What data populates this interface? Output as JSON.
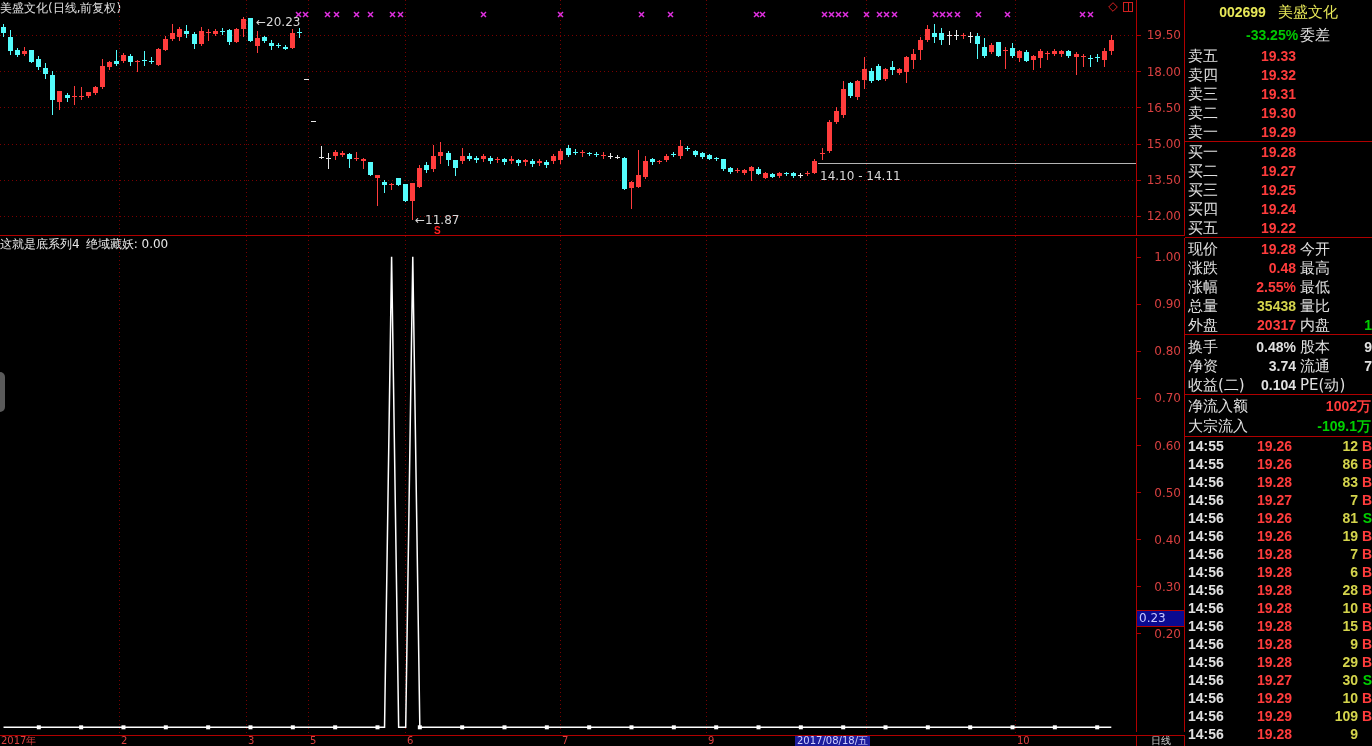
{
  "price_chart": {
    "title": "美盛文化(日线,前复权)",
    "high_label": "←20.23",
    "low_label": "←11.87",
    "signal_label": "S",
    "price_line_label": "14.10 - 14.11",
    "chart_data": {
      "type": "candlestick",
      "grid": true,
      "categories": [
        null,
        null,
        null,
        null,
        null,
        null,
        null,
        null,
        null,
        null,
        null,
        null,
        null,
        null,
        null,
        null,
        null,
        null,
        null,
        null,
        null,
        null,
        null,
        null,
        null,
        null,
        null,
        null,
        null,
        null,
        null,
        null,
        null,
        null,
        null,
        null,
        null,
        null,
        null,
        null,
        null,
        null,
        null,
        null,
        null,
        null,
        null,
        null,
        null,
        null,
        null,
        null,
        null,
        null,
        null,
        null,
        null,
        null,
        null,
        null,
        null,
        null,
        null,
        null,
        null,
        null,
        null,
        null,
        null,
        null,
        null,
        null,
        null,
        null,
        null,
        null,
        null,
        null,
        null,
        null,
        null,
        null,
        null,
        null,
        null,
        null,
        null,
        null,
        null,
        null,
        null,
        null,
        null,
        null,
        null,
        null,
        null,
        null,
        null,
        null,
        null,
        null,
        null,
        null,
        null,
        null,
        null,
        null,
        null,
        null,
        null,
        null,
        null,
        null,
        null,
        null,
        null,
        null,
        null,
        null,
        null,
        null,
        null,
        null,
        null,
        null,
        null,
        null,
        null,
        null,
        null,
        null,
        null,
        null,
        null,
        null,
        null,
        null,
        null,
        null,
        null,
        null,
        null,
        null,
        null,
        null,
        null,
        null,
        null,
        null,
        null,
        null,
        null,
        null,
        null,
        null,
        null,
        null,
        null,
        null,
        null
      ],
      "ohlc": [
        [
          19.82,
          19.94,
          19.46,
          19.58
        ],
        [
          19.42,
          19.7,
          18.7,
          18.82
        ],
        [
          18.86,
          18.94,
          18.62,
          18.66
        ],
        [
          18.7,
          19.02,
          18.66,
          18.82
        ],
        [
          18.86,
          18.86,
          18.38,
          18.38
        ],
        [
          18.5,
          18.62,
          18.1,
          18.18
        ],
        [
          18.14,
          18.34,
          17.7,
          17.9
        ],
        [
          17.86,
          18.02,
          16.22,
          16.82
        ],
        [
          16.74,
          17.18,
          16.42,
          17.18
        ],
        [
          17.02,
          17.1,
          16.78,
          16.9
        ],
        [
          16.94,
          17.38,
          16.66,
          16.98
        ],
        [
          16.94,
          17.34,
          16.86,
          16.98
        ],
        [
          16.98,
          17.14,
          16.94,
          17.14
        ],
        [
          17.1,
          17.38,
          17.06,
          17.34
        ],
        [
          17.34,
          18.5,
          17.3,
          18.22
        ],
        [
          18.18,
          18.42,
          18.1,
          18.38
        ],
        [
          18.42,
          18.86,
          18.26,
          18.3
        ],
        [
          18.42,
          18.74,
          18.38,
          18.66
        ],
        [
          18.62,
          18.7,
          18.26,
          18.38
        ],
        [
          18.38,
          18.46,
          18.02,
          18.42
        ],
        [
          18.46,
          18.82,
          18.26,
          18.42
        ],
        [
          18.42,
          18.58,
          18.34,
          18.38
        ],
        [
          18.26,
          18.94,
          18.26,
          18.9
        ],
        [
          18.86,
          19.46,
          18.86,
          19.34
        ],
        [
          19.34,
          19.94,
          19.3,
          19.58
        ],
        [
          19.42,
          19.82,
          19.3,
          19.74
        ],
        [
          19.66,
          19.9,
          19.42,
          19.54
        ],
        [
          19.54,
          19.62,
          18.98,
          19.14
        ],
        [
          19.14,
          19.82,
          19.1,
          19.66
        ],
        [
          19.58,
          19.74,
          19.3,
          19.62
        ],
        [
          19.54,
          19.74,
          19.5,
          19.66
        ],
        [
          19.66,
          19.78,
          19.54,
          19.62
        ],
        [
          19.7,
          19.74,
          19.14,
          19.22
        ],
        [
          19.22,
          19.78,
          19.22,
          19.74
        ],
        [
          19.74,
          20.23,
          19.46,
          20.18
        ],
        [
          20.22,
          20.22,
          19.26,
          19.26
        ],
        [
          19.06,
          19.66,
          18.78,
          19.38
        ],
        [
          19.42,
          19.46,
          19.22,
          19.26
        ],
        [
          19.18,
          19.3,
          18.9,
          19.06
        ],
        [
          19.1,
          19.18,
          19.02,
          19.06
        ],
        [
          19.02,
          19.1,
          18.9,
          18.9
        ],
        [
          18.94,
          19.74,
          18.94,
          19.58
        ],
        [
          19.62,
          19.78,
          19.42,
          19.58
        ],
        [
          17.66,
          17.66,
          17.66,
          17.66
        ],
        [
          15.94,
          15.94,
          15.94,
          15.94
        ],
        [
          14.46,
          14.9,
          14.42,
          14.46
        ],
        [
          14.42,
          14.62,
          13.98,
          14.42
        ],
        [
          14.5,
          14.74,
          14.38,
          14.66
        ],
        [
          14.54,
          14.7,
          14.5,
          14.62
        ],
        [
          14.58,
          14.62,
          14.02,
          14.38
        ],
        [
          14.38,
          14.66,
          14.3,
          14.42
        ],
        [
          14.26,
          14.42,
          13.98,
          14.38
        ],
        [
          14.22,
          14.22,
          13.7,
          13.7
        ],
        [
          13.58,
          13.7,
          12.46,
          13.7
        ],
        [
          13.42,
          13.5,
          12.98,
          13.3
        ],
        [
          13.3,
          13.38,
          13.1,
          13.34
        ],
        [
          13.58,
          13.58,
          13.3,
          13.3
        ],
        [
          13.34,
          13.34,
          12.62,
          12.62
        ],
        [
          12.62,
          13.38,
          11.87,
          13.38
        ],
        [
          13.22,
          14.1,
          13.22,
          13.98
        ],
        [
          14.1,
          14.22,
          13.82,
          13.9
        ],
        [
          13.94,
          14.94,
          13.86,
          14.5
        ],
        [
          14.5,
          15.06,
          14.18,
          14.66
        ],
        [
          14.62,
          14.7,
          14.1,
          14.3
        ],
        [
          14.3,
          14.3,
          13.7,
          13.98
        ],
        [
          14.26,
          14.82,
          14.18,
          14.5
        ],
        [
          14.5,
          14.62,
          14.3,
          14.38
        ],
        [
          14.42,
          14.5,
          14.22,
          14.3
        ],
        [
          14.34,
          14.58,
          14.26,
          14.5
        ],
        [
          14.42,
          14.5,
          14.18,
          14.26
        ],
        [
          14.3,
          14.46,
          14.22,
          14.38
        ],
        [
          14.34,
          14.42,
          14.14,
          14.22
        ],
        [
          14.26,
          14.5,
          14.18,
          14.38
        ],
        [
          14.3,
          14.38,
          14.1,
          14.18
        ],
        [
          14.22,
          14.38,
          14.1,
          14.3
        ],
        [
          14.26,
          14.34,
          14.06,
          14.14
        ],
        [
          14.18,
          14.38,
          14.1,
          14.26
        ],
        [
          14.22,
          14.3,
          14.02,
          14.1
        ],
        [
          14.26,
          14.58,
          14.18,
          14.5
        ],
        [
          14.3,
          14.78,
          14.18,
          14.7
        ],
        [
          14.82,
          14.94,
          14.5,
          14.54
        ],
        [
          14.66,
          14.78,
          14.58,
          14.62
        ],
        [
          14.62,
          14.74,
          14.5,
          14.66
        ],
        [
          14.62,
          14.66,
          14.54,
          14.58
        ],
        [
          14.58,
          14.66,
          14.5,
          14.54
        ],
        [
          14.5,
          14.66,
          14.42,
          14.54
        ],
        [
          14.5,
          14.62,
          14.42,
          14.5
        ],
        [
          14.46,
          14.54,
          14.42,
          14.46
        ],
        [
          14.42,
          14.46,
          13.1,
          13.1
        ],
        [
          13.14,
          13.46,
          12.34,
          13.42
        ],
        [
          13.18,
          14.74,
          13.18,
          13.7
        ],
        [
          13.62,
          14.5,
          13.58,
          14.26
        ],
        [
          14.38,
          14.42,
          14.14,
          14.22
        ],
        [
          14.22,
          14.3,
          14.18,
          14.26
        ],
        [
          14.3,
          14.58,
          14.26,
          14.5
        ],
        [
          14.58,
          14.66,
          14.5,
          14.54
        ],
        [
          14.5,
          15.14,
          14.42,
          14.9
        ],
        [
          14.82,
          14.9,
          14.74,
          14.78
        ],
        [
          14.7,
          14.74,
          14.5,
          14.54
        ],
        [
          14.62,
          14.66,
          14.42,
          14.46
        ],
        [
          14.54,
          14.58,
          14.34,
          14.38
        ],
        [
          14.42,
          14.46,
          14.3,
          14.34
        ],
        [
          14.38,
          14.38,
          13.9,
          13.94
        ],
        [
          13.98,
          14.02,
          13.78,
          13.82
        ],
        [
          13.86,
          13.98,
          13.82,
          13.9
        ],
        [
          13.78,
          13.94,
          13.74,
          13.9
        ],
        [
          13.86,
          14.06,
          13.5,
          14.02
        ],
        [
          13.94,
          14.02,
          13.74,
          13.74
        ],
        [
          13.58,
          13.82,
          13.58,
          13.78
        ],
        [
          13.74,
          13.78,
          13.62,
          13.62
        ],
        [
          13.66,
          13.82,
          13.62,
          13.78
        ],
        [
          13.78,
          13.82,
          13.7,
          13.74
        ],
        [
          13.78,
          13.82,
          13.62,
          13.66
        ],
        [
          13.7,
          13.78,
          13.62,
          13.7
        ],
        [
          13.74,
          13.86,
          13.7,
          13.78
        ],
        [
          13.78,
          14.34,
          13.78,
          14.26
        ],
        [
          14.58,
          14.82,
          14.38,
          14.62
        ],
        [
          14.7,
          15.98,
          14.66,
          15.9
        ],
        [
          15.9,
          16.5,
          15.86,
          16.34
        ],
        [
          16.18,
          17.58,
          16.1,
          17.26
        ],
        [
          17.5,
          17.54,
          16.94,
          16.98
        ],
        [
          16.94,
          17.62,
          16.86,
          17.58
        ],
        [
          17.62,
          18.58,
          17.3,
          18.1
        ],
        [
          18.02,
          18.14,
          17.54,
          17.58
        ],
        [
          18.22,
          18.3,
          17.62,
          17.62
        ],
        [
          17.66,
          18.14,
          17.62,
          18.1
        ],
        [
          18.18,
          18.42,
          17.9,
          18.06
        ],
        [
          17.94,
          18.14,
          17.9,
          18.1
        ],
        [
          17.98,
          18.62,
          17.54,
          18.58
        ],
        [
          18.46,
          18.9,
          18.14,
          18.7
        ],
        [
          18.86,
          19.42,
          18.5,
          19.3
        ],
        [
          19.3,
          19.9,
          19.26,
          19.74
        ],
        [
          19.58,
          19.94,
          19.22,
          19.42
        ],
        [
          19.58,
          19.78,
          19.14,
          19.3
        ],
        [
          19.5,
          19.66,
          19.14,
          19.5
        ],
        [
          19.5,
          19.7,
          19.34,
          19.5
        ],
        [
          19.46,
          19.58,
          19.38,
          19.5
        ],
        [
          19.46,
          19.62,
          19.22,
          19.46
        ],
        [
          19.46,
          19.58,
          18.54,
          19.14
        ],
        [
          19.02,
          19.38,
          18.58,
          18.62
        ],
        [
          18.78,
          19.18,
          18.74,
          19.1
        ],
        [
          19.22,
          19.22,
          18.62,
          18.62
        ],
        [
          18.82,
          19.02,
          18.14,
          18.86
        ],
        [
          18.98,
          19.18,
          18.58,
          18.62
        ],
        [
          18.54,
          18.86,
          18.42,
          18.82
        ],
        [
          18.78,
          18.86,
          18.42,
          18.42
        ],
        [
          18.46,
          18.66,
          18.1,
          18.62
        ],
        [
          18.54,
          18.9,
          18.18,
          18.82
        ],
        [
          18.7,
          18.82,
          18.5,
          18.74
        ],
        [
          18.7,
          18.9,
          18.66,
          18.82
        ],
        [
          18.7,
          18.86,
          18.62,
          18.82
        ],
        [
          18.82,
          18.86,
          18.58,
          18.62
        ],
        [
          18.58,
          18.78,
          17.9,
          18.7
        ],
        [
          18.58,
          18.7,
          18.22,
          18.62
        ],
        [
          18.54,
          18.66,
          18.22,
          18.5
        ],
        [
          18.58,
          18.7,
          18.42,
          18.54
        ],
        [
          18.46,
          18.94,
          18.22,
          18.82
        ],
        [
          18.82,
          19.5,
          18.7,
          19.28
        ],
        null,
        null,
        null
      ],
      "ylim": [
        11.21,
        20.95
      ],
      "yticks": [
        {
          "value": 19.5,
          "label": "19.50"
        },
        {
          "value": 18,
          "label": "18.00"
        },
        {
          "value": 16.5,
          "label": "16.50"
        },
        {
          "value": 15,
          "label": "15.00"
        },
        {
          "value": 13.5,
          "label": "13.50"
        },
        {
          "value": 12,
          "label": "12.00"
        }
      ]
    }
  },
  "indicator": {
    "title": "这就是底系列4",
    "legend": "绝域藏妖: 0.00",
    "current_value": "0.23",
    "chart_data": {
      "type": "line",
      "grid": true,
      "categories": [
        null,
        null,
        null,
        null,
        null,
        null,
        null,
        null,
        null,
        null,
        null,
        null,
        null,
        null,
        null,
        null,
        null,
        null,
        null,
        null,
        null,
        null,
        null,
        null,
        null,
        null,
        null,
        null,
        null,
        null,
        null,
        null,
        null,
        null,
        null,
        null,
        null,
        null,
        null,
        null,
        null,
        null,
        null,
        null,
        null,
        null,
        null,
        null,
        null,
        null,
        null,
        null,
        null,
        null,
        null,
        null,
        null,
        null,
        null,
        null,
        null,
        null,
        null,
        null,
        null,
        null,
        null,
        null,
        null,
        null,
        null,
        null,
        null,
        null,
        null,
        null,
        null,
        null,
        null,
        null,
        null,
        null,
        null,
        null,
        null,
        null,
        null,
        null,
        null,
        null,
        null,
        null,
        null,
        null,
        null,
        null,
        null,
        null,
        null,
        null,
        null,
        null,
        null,
        null,
        null,
        null,
        null,
        null,
        null,
        null,
        null,
        null,
        null,
        null,
        null,
        null,
        null,
        null,
        null,
        null,
        null,
        null,
        null,
        null,
        null,
        null,
        null,
        null,
        null,
        null,
        null,
        null,
        null,
        null,
        null,
        null,
        null,
        null,
        null,
        null,
        null,
        null,
        null,
        null,
        null,
        null,
        null,
        null,
        null,
        null,
        null,
        null,
        null,
        null,
        null,
        null,
        null,
        null,
        null,
        null,
        null
      ],
      "series": [
        {
          "color": "#ffffff",
          "values": [
            0,
            0,
            0,
            0,
            0,
            0,
            0,
            0,
            0,
            0,
            0,
            0,
            0,
            0,
            0,
            0,
            0,
            0,
            0,
            0,
            0,
            0,
            0,
            0,
            0,
            0,
            0,
            0,
            0,
            0,
            0,
            0,
            0,
            0,
            0,
            0,
            0,
            0,
            0,
            0,
            0,
            0,
            0,
            0,
            0,
            0,
            0,
            0,
            0,
            0,
            0,
            0,
            0,
            0,
            0,
            1,
            0,
            0,
            1,
            0,
            0,
            0,
            0,
            0,
            0,
            0,
            0,
            0,
            0,
            0,
            0,
            0,
            0,
            0,
            0,
            0,
            0,
            0,
            0,
            0,
            0,
            0,
            0,
            0,
            0,
            0,
            0,
            0,
            0,
            0,
            0,
            0,
            0,
            0,
            0,
            0,
            0,
            0,
            0,
            0,
            0,
            0,
            0,
            0,
            0,
            0,
            0,
            0,
            0,
            0,
            0,
            0,
            0,
            0,
            0,
            0,
            0,
            0,
            0,
            0,
            0,
            0,
            0,
            0,
            0,
            0,
            0,
            0,
            0,
            0,
            0,
            0,
            0,
            0,
            0,
            0,
            0,
            0,
            0,
            0,
            0,
            0,
            0,
            0,
            0,
            0,
            0,
            0,
            0,
            0,
            0,
            0,
            0,
            0,
            0,
            0,
            0,
            0,
            null,
            null,
            null
          ]
        }
      ],
      "ylim": [
        -0.01,
        1.04
      ],
      "yticks": [
        {
          "value": 1,
          "label": "1.00"
        },
        {
          "value": 0.9,
          "label": "0.90"
        },
        {
          "value": 0.8,
          "label": "0.80"
        },
        {
          "value": 0.7,
          "label": "0.70"
        },
        {
          "value": 0.6,
          "label": "0.60"
        },
        {
          "value": 0.5,
          "label": "0.50"
        },
        {
          "value": 0.4,
          "label": "0.40"
        },
        {
          "value": 0.3,
          "label": "0.30"
        },
        {
          "value": 0.2,
          "label": "0.20"
        }
      ]
    }
  },
  "time_axis": {
    "labels": [
      "2017年",
      "2",
      "3",
      "5",
      "6",
      "7",
      "9",
      "10"
    ],
    "cursor_date": "2017/08/18/五",
    "period": "日线"
  },
  "quote_panel": {
    "code": "002699",
    "name": "美盛文化",
    "ratio_value": "-33.25%",
    "ratio_diff_label": "委差",
    "asks": [
      {
        "label": "卖五",
        "price": "19.33"
      },
      {
        "label": "卖四",
        "price": "19.32"
      },
      {
        "label": "卖三",
        "price": "19.31"
      },
      {
        "label": "卖二",
        "price": "19.30"
      },
      {
        "label": "卖一",
        "price": "19.29"
      }
    ],
    "bids": [
      {
        "label": "买一",
        "price": "19.28"
      },
      {
        "label": "买二",
        "price": "19.27"
      },
      {
        "label": "买三",
        "price": "19.25"
      },
      {
        "label": "买四",
        "price": "19.24"
      },
      {
        "label": "买五",
        "price": "19.22"
      }
    ],
    "stats": [
      {
        "left": {
          "label": "现价",
          "value": "19.28",
          "color": "#ff3c3c"
        },
        "right": {
          "label": "今开"
        }
      },
      {
        "left": {
          "label": "涨跌",
          "value": "0.48",
          "color": "#ff3c3c"
        },
        "right": {
          "label": "最高"
        }
      },
      {
        "left": {
          "label": "涨幅",
          "value": "2.55%",
          "color": "#ff3c3c"
        },
        "right": {
          "label": "最低"
        }
      },
      {
        "left": {
          "label": "总量",
          "value": "35438",
          "color": "#d4d44c"
        },
        "right": {
          "label": "量比"
        }
      },
      {
        "left": {
          "label": "外盘",
          "value": "20317",
          "color": "#ff3c3c"
        },
        "right": {
          "label": "内盘",
          "value": "1",
          "color": "#00d000"
        }
      }
    ],
    "fundamentals": [
      {
        "left": {
          "label": "换手",
          "value": "0.48%",
          "color": "#e0e0e0"
        },
        "right": {
          "label": "股本",
          "value": "9",
          "color": "#e0e0e0"
        }
      },
      {
        "left": {
          "label": "净资",
          "value": "3.74",
          "color": "#e0e0e0"
        },
        "right": {
          "label": "流通",
          "value": "7",
          "color": "#e0e0e0"
        }
      },
      {
        "left": {
          "label": "收益(二)",
          "value": "0.104",
          "color": "#e0e0e0"
        },
        "right": {
          "label": "PE(动)"
        }
      }
    ],
    "flows": [
      {
        "label": "净流入额",
        "value": "1002万",
        "color": "#ff3c3c"
      },
      {
        "label": "大宗流入",
        "value": "-109.1万",
        "color": "#00d000"
      }
    ],
    "ticks": [
      {
        "time": "14:55",
        "price": "19.26",
        "volume": "12",
        "flag": "B",
        "kind": "buy"
      },
      {
        "time": "14:55",
        "price": "19.26",
        "volume": "86",
        "flag": "B",
        "kind": "buy"
      },
      {
        "time": "14:56",
        "price": "19.28",
        "volume": "83",
        "flag": "B",
        "kind": "buy"
      },
      {
        "time": "14:56",
        "price": "19.27",
        "volume": "7",
        "flag": "B",
        "kind": "buy"
      },
      {
        "time": "14:56",
        "price": "19.26",
        "volume": "81",
        "flag": "S",
        "kind": "sell"
      },
      {
        "time": "14:56",
        "price": "19.26",
        "volume": "19",
        "flag": "B",
        "kind": "buy"
      },
      {
        "time": "14:56",
        "price": "19.28",
        "volume": "7",
        "flag": "B",
        "kind": "buy"
      },
      {
        "time": "14:56",
        "price": "19.28",
        "volume": "6",
        "flag": "B",
        "kind": "buy"
      },
      {
        "time": "14:56",
        "price": "19.28",
        "volume": "28",
        "flag": "B",
        "kind": "buy"
      },
      {
        "time": "14:56",
        "price": "19.28",
        "volume": "10",
        "flag": "B",
        "kind": "buy"
      },
      {
        "time": "14:56",
        "price": "19.28",
        "volume": "15",
        "flag": "B",
        "kind": "buy"
      },
      {
        "time": "14:56",
        "price": "19.28",
        "volume": "9",
        "flag": "B",
        "kind": "buy"
      },
      {
        "time": "14:56",
        "price": "19.28",
        "volume": "29",
        "flag": "B",
        "kind": "buy"
      },
      {
        "time": "14:56",
        "price": "19.27",
        "volume": "30",
        "flag": "S",
        "kind": "sell"
      },
      {
        "time": "14:56",
        "price": "19.29",
        "volume": "10",
        "flag": "B",
        "kind": "buy"
      },
      {
        "time": "14:56",
        "price": "19.29",
        "volume": "109",
        "flag": "B",
        "kind": "buy"
      },
      {
        "time": "14:56",
        "price": "19.28",
        "volume": "9"
      }
    ]
  }
}
